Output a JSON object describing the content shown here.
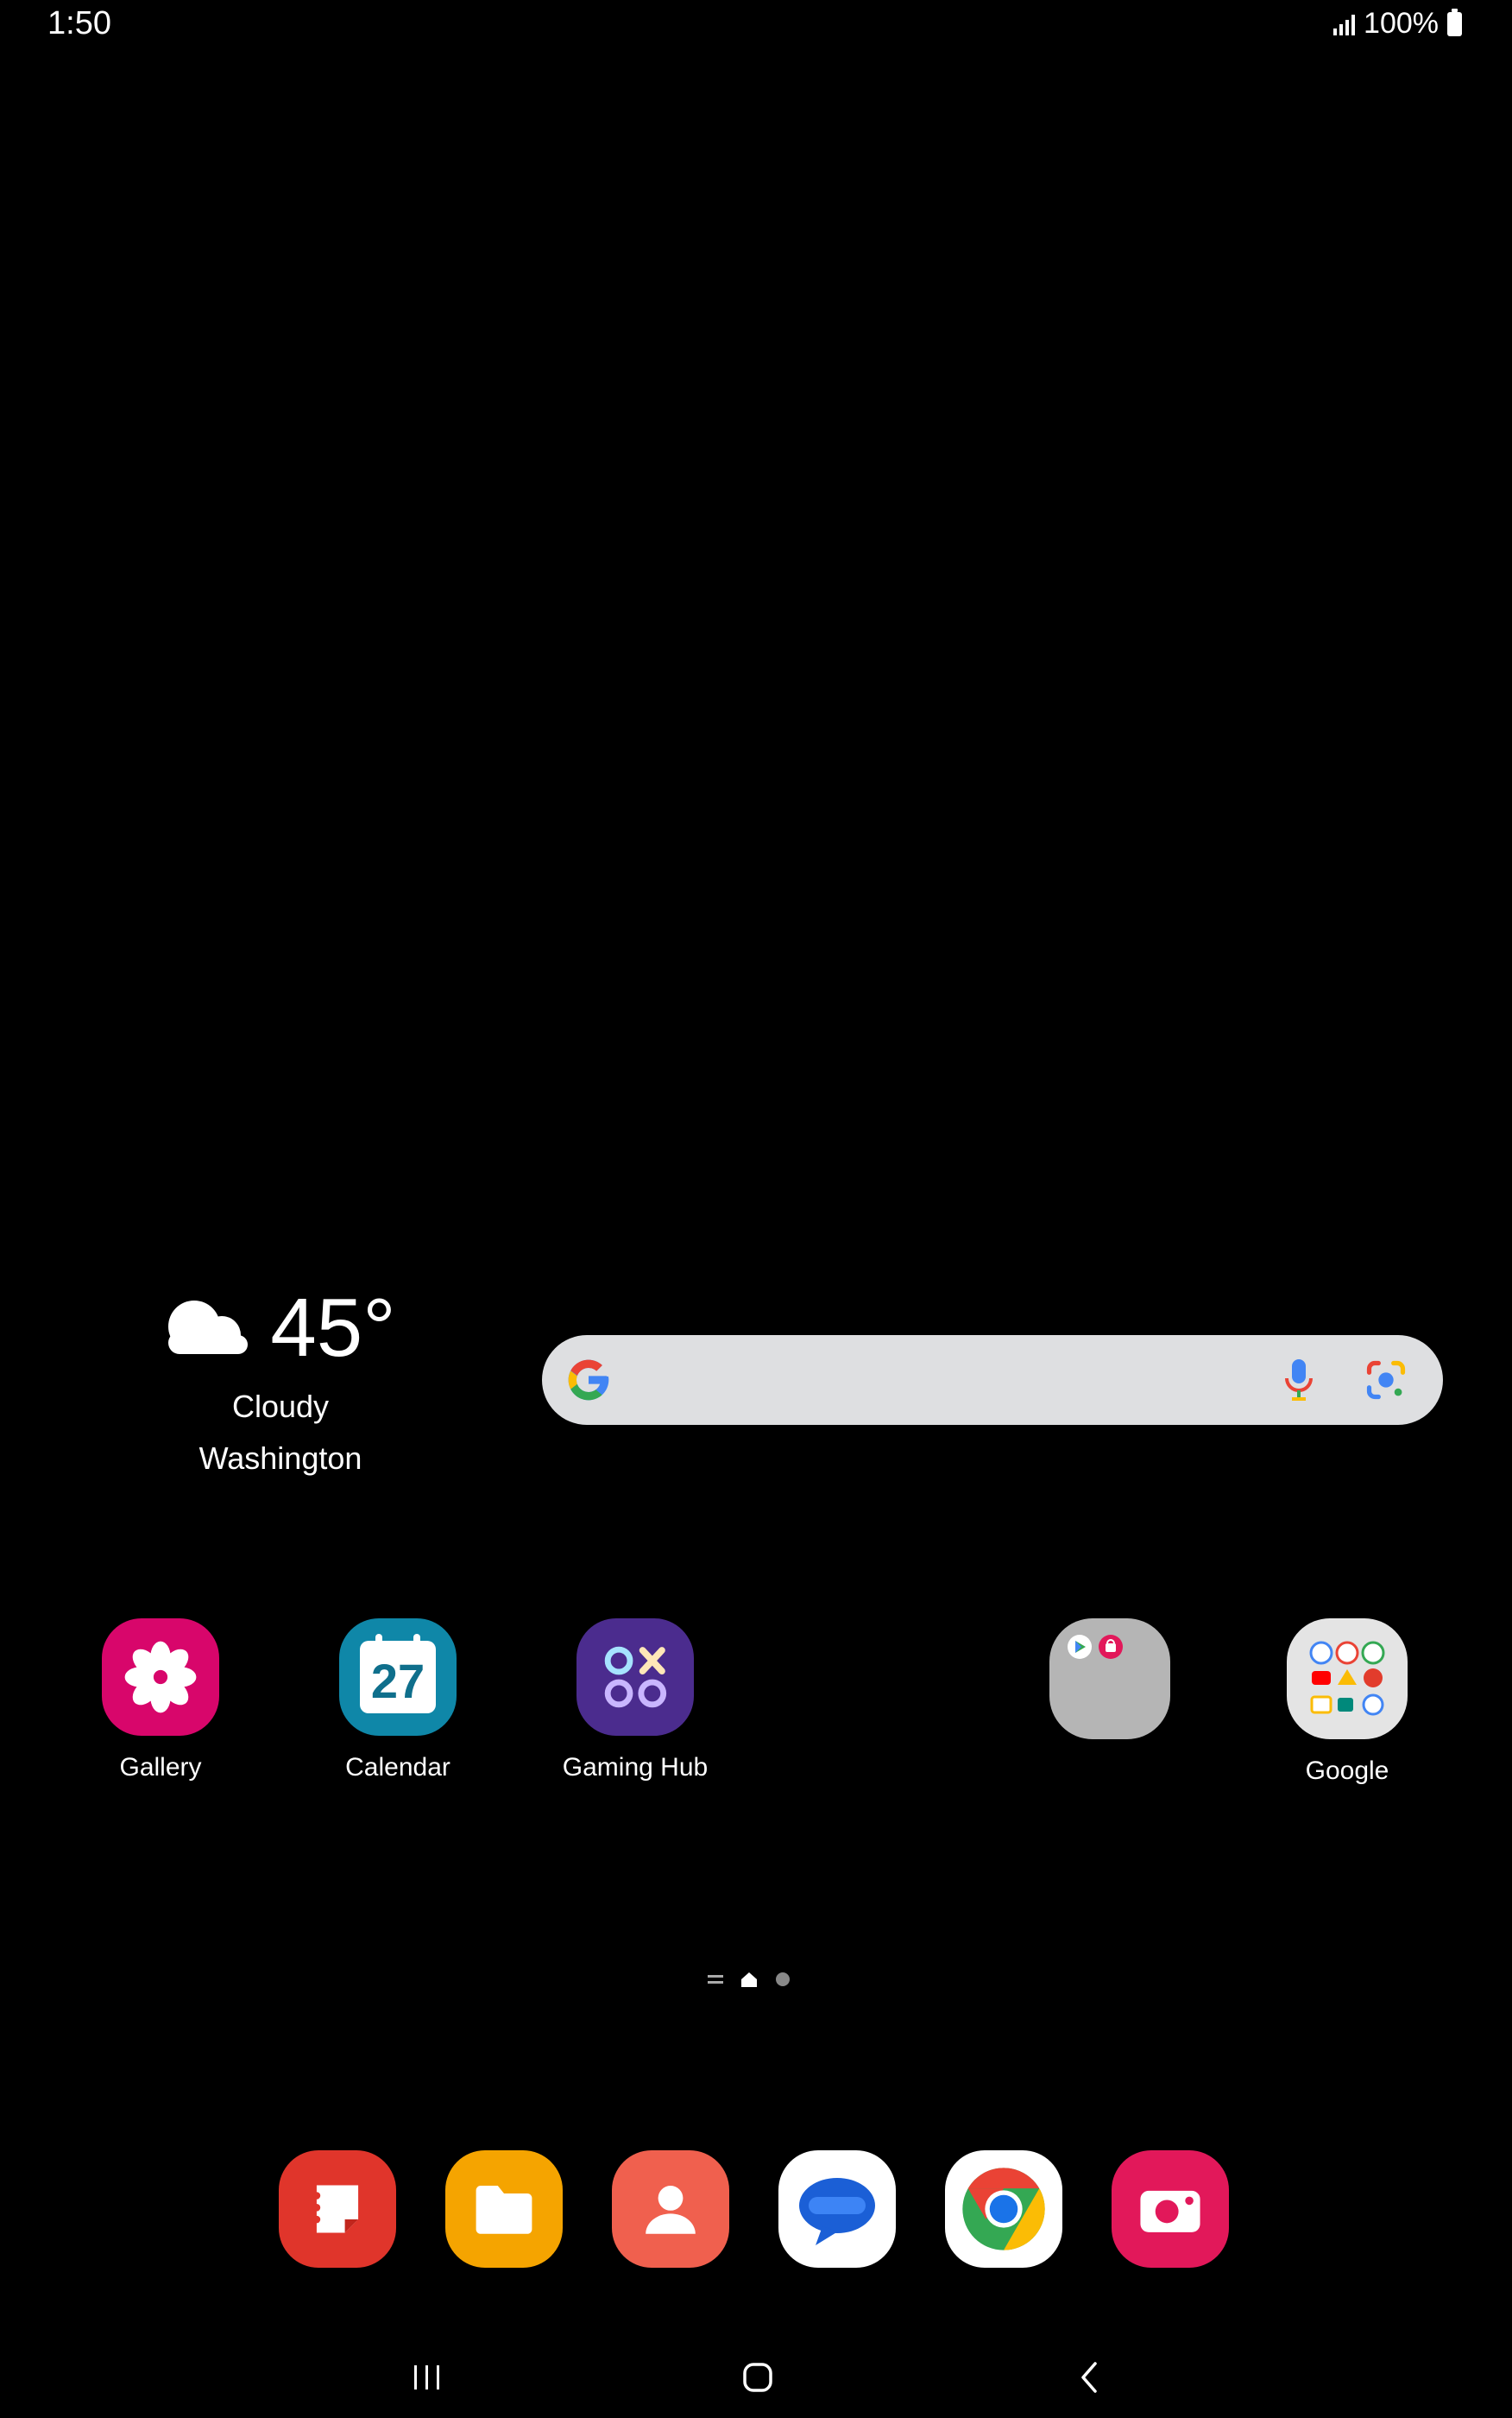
{
  "status_bar": {
    "time": "1:50",
    "battery_text": "100%",
    "icons": [
      "signal-icon",
      "battery-icon"
    ]
  },
  "weather": {
    "temperature": "45°",
    "condition": "Cloudy",
    "location": "Washington",
    "icon": "cloud-icon"
  },
  "search_bar": {
    "icons": [
      "google-logo-icon",
      "microphone-icon",
      "google-lens-icon"
    ]
  },
  "apps": [
    {
      "label": "Gallery",
      "icon": "gallery-icon",
      "color": "#d8066b"
    },
    {
      "label": "Calendar",
      "icon": "calendar-icon",
      "color": "#0f87a8",
      "date": "27"
    },
    {
      "label": "Gaming Hub",
      "icon": "gaming-hub-icon",
      "color": "#4b2c8e"
    },
    {
      "label": "",
      "icon": "folder-icon",
      "color": "#b5b5b5"
    },
    {
      "label": "Google",
      "icon": "google-folder-icon",
      "color": "#e4e4e4"
    }
  ],
  "dock": [
    {
      "icon": "samsung-notes-icon",
      "color": "#e0352b"
    },
    {
      "icon": "my-files-icon",
      "color": "#f5a400"
    },
    {
      "icon": "contacts-icon",
      "color": "#f0604e"
    },
    {
      "icon": "messages-icon",
      "color": "#ffffff"
    },
    {
      "icon": "chrome-icon",
      "color": "#ffffff"
    },
    {
      "icon": "camera-icon",
      "color": "#e2185a"
    }
  ],
  "navigation": {
    "icons": [
      "recent-apps-icon",
      "home-icon",
      "back-icon"
    ]
  }
}
